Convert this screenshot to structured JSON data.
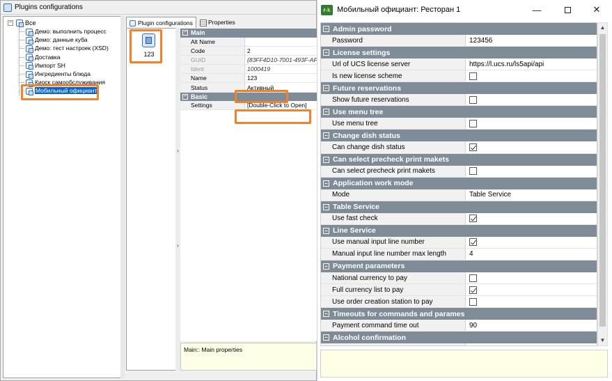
{
  "left_window": {
    "title": "Plugins configurations",
    "tree": {
      "root_label": "Все",
      "items": [
        {
          "label": "Демо: выполнить процесс",
          "selected": false
        },
        {
          "label": "Демо: данные куба",
          "selected": false
        },
        {
          "label": "Демо: тест настроек (XSD)",
          "selected": false
        },
        {
          "label": "Доставка",
          "selected": false
        },
        {
          "label": "Импорт SH",
          "selected": false
        },
        {
          "label": "Ингредиенты блюда",
          "selected": false
        },
        {
          "label": "Киоск самообслуживания",
          "selected": false
        },
        {
          "label": "Мобильный официант",
          "selected": true
        }
      ]
    },
    "tabs": [
      {
        "label": "Plugin configurations",
        "icon": "plugin-icon"
      },
      {
        "label": "Properties",
        "icon": "properties-icon"
      }
    ],
    "plugin_tile": {
      "caption": "123",
      "icon": "plugin-icon"
    },
    "property_grid": {
      "categories": [
        {
          "name": "Main",
          "rows": [
            {
              "key": "Alt Name",
              "value": "",
              "dim": false,
              "italic": false
            },
            {
              "key": "Code",
              "value": "2",
              "dim": false,
              "italic": false
            },
            {
              "key": "GUID",
              "value": "{83FF4D10-7001-493F-AF",
              "dim": true,
              "italic": true
            },
            {
              "key": "Ident",
              "value": "1000419",
              "dim": true,
              "italic": true
            },
            {
              "key": "Name",
              "value": "123",
              "dim": false,
              "italic": false
            },
            {
              "key": "Status",
              "value": "Активный",
              "dim": false,
              "italic": false
            }
          ]
        },
        {
          "name": "Basic",
          "rows": [
            {
              "key": "Settings",
              "value": "[Double-Click to Open]",
              "dim": false,
              "italic": false
            }
          ]
        }
      ]
    },
    "description": "Main:: Main properties"
  },
  "right_window": {
    "title": "Мобильный официант: Ресторан 1",
    "icon_text": "r-k",
    "categories": [
      {
        "name": "Admin password",
        "rows": [
          {
            "key": "Password",
            "type": "text",
            "value": "123456"
          }
        ]
      },
      {
        "name": "License settings",
        "rows": [
          {
            "key": "Url of UCS license server",
            "type": "text",
            "value": "https://l.ucs.ru/ls5api/api"
          },
          {
            "key": "Is new license scheme",
            "type": "check",
            "value": false
          }
        ]
      },
      {
        "name": "Future reservations",
        "rows": [
          {
            "key": "Show future reservations",
            "type": "check",
            "value": false
          }
        ]
      },
      {
        "name": "Use menu tree",
        "rows": [
          {
            "key": "Use menu tree",
            "type": "check",
            "value": false
          }
        ]
      },
      {
        "name": "Change dish status",
        "rows": [
          {
            "key": "Can change dish status",
            "type": "check",
            "value": true
          }
        ]
      },
      {
        "name": "Can select precheck print makets",
        "rows": [
          {
            "key": "Can select precheck print makets",
            "type": "check",
            "value": false
          }
        ]
      },
      {
        "name": "Application work mode",
        "rows": [
          {
            "key": "Mode",
            "type": "text",
            "value": "Table Service"
          }
        ]
      },
      {
        "name": "Table Service",
        "rows": [
          {
            "key": "Use fast check",
            "type": "check",
            "value": true
          }
        ]
      },
      {
        "name": "Line Service",
        "rows": [
          {
            "key": "Use manual input line number",
            "type": "check",
            "value": true
          },
          {
            "key": "Manual input line number max length",
            "type": "text",
            "value": "4"
          }
        ]
      },
      {
        "name": "Payment parameters",
        "rows": [
          {
            "key": "National currency to pay",
            "type": "check",
            "value": false
          },
          {
            "key": "Full currency list to pay",
            "type": "check",
            "value": true
          },
          {
            "key": "Use order creation station to pay",
            "type": "check",
            "value": false
          }
        ]
      },
      {
        "name": "Timeouts for commands and parames",
        "rows": [
          {
            "key": "Payment command time out",
            "type": "text",
            "value": "90"
          }
        ]
      },
      {
        "name": "Alcohol confirmation",
        "rows": [
          {
            "key": "",
            "type": "check",
            "value": false
          }
        ]
      }
    ]
  },
  "colors": {
    "highlight": "#f0822a",
    "category_bg": "#7f8c97",
    "selection": "#0a64c8",
    "description_bg": "#ffffe6"
  }
}
